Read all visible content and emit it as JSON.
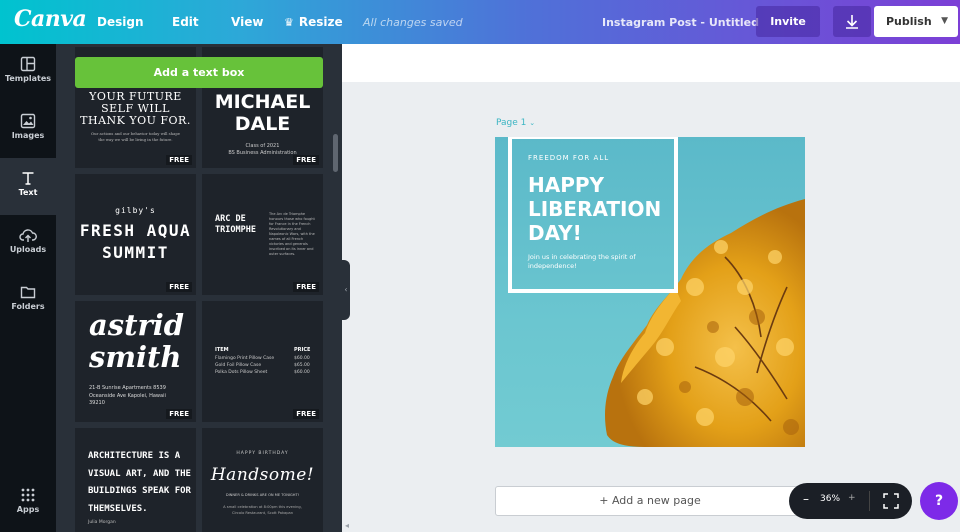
{
  "topbar": {
    "logo": "Canva",
    "menu": [
      "Design",
      "Edit",
      "View"
    ],
    "resize_label": "Resize",
    "save_status": "All changes saved",
    "doc_title": "Instagram Post - Untitled",
    "invite_label": "Invite",
    "publish_label": "Publish",
    "icons": {
      "resize": "crown-icon",
      "download": "download-icon",
      "publish": "chevron-down-icon"
    }
  },
  "leftnav": {
    "items": [
      {
        "label": "Templates",
        "icon": "templates-icon"
      },
      {
        "label": "Images",
        "icon": "image-icon"
      },
      {
        "label": "Text",
        "icon": "text-icon",
        "active": true
      },
      {
        "label": "Uploads",
        "icon": "upload-cloud-icon"
      },
      {
        "label": "Folders",
        "icon": "folder-icon"
      }
    ],
    "apps_label": "Apps"
  },
  "panel": {
    "add_text_label": "Add a text box",
    "free_badge": "FREE",
    "tiles": {
      "future": {
        "heading": "YOUR FUTURE\nSELF WILL\nTHANK YOU FOR.",
        "body": "Our actions and our behavior today will shape\nthe way we will be living in the future."
      },
      "michael": {
        "name": "MICHAEL\nDALE",
        "line1": "Class of 2021",
        "line2": "BS Business Administration"
      },
      "gilby": {
        "small": "gilby's",
        "big": "FRESH AQUA\nSUMMIT"
      },
      "arc": {
        "heading": "ARC DE\nTRIOMPHE",
        "body": "The Arc de Triomphe honours those who fought for France in the French Revolutionary and Napoleonic Wars, with the names of all French victories and generals inscribed on its inner and outer surfaces."
      },
      "astrid": {
        "name": "astrid\nsmith",
        "address": "21-B Sunrise Apartments 8539\nOceanside Ave Kapolei, Hawaii\n39210"
      },
      "menu": {
        "col_item": "ITEM",
        "col_price": "PRICE",
        "rows": [
          {
            "item": "Flamingo Print Pillow Case",
            "price": "$60.00"
          },
          {
            "item": "Gold Foil Pillow Case",
            "price": "$65.00"
          },
          {
            "item": "Polka Dots Pillow Sheet",
            "price": "$60.00"
          }
        ]
      },
      "architecture": {
        "quote": "ARCHITECTURE IS A\nVISUAL ART, AND THE\nBUILDINGS SPEAK FOR\nTHEMSELVES.",
        "author": "Julia Morgan"
      },
      "birthday": {
        "small": "HAPPY BIRTHDAY",
        "big": "Handsome!",
        "line1": "DINNER & DRINKS ARE ON ME TONIGHT!",
        "line2": "A small celebration at 8:00pm this evening,\nCircolo Restaurant, Scott Pakapan"
      }
    }
  },
  "canvas": {
    "page_label": "Page 1",
    "design": {
      "kicker": "FREEDOM FOR ALL",
      "headline": "HAPPY\nLIBERATION\nDAY!",
      "subtext": "Join us in celebrating the spirit of\nindependence!"
    },
    "add_page_label": "+ Add a new page",
    "zoom": "36%",
    "help": "?"
  },
  "colors": {
    "accent_green": "#67c23a",
    "design_teal": "#5bb9c9",
    "foliage": "#e8a51c",
    "help_purple": "#7d2ae8"
  }
}
